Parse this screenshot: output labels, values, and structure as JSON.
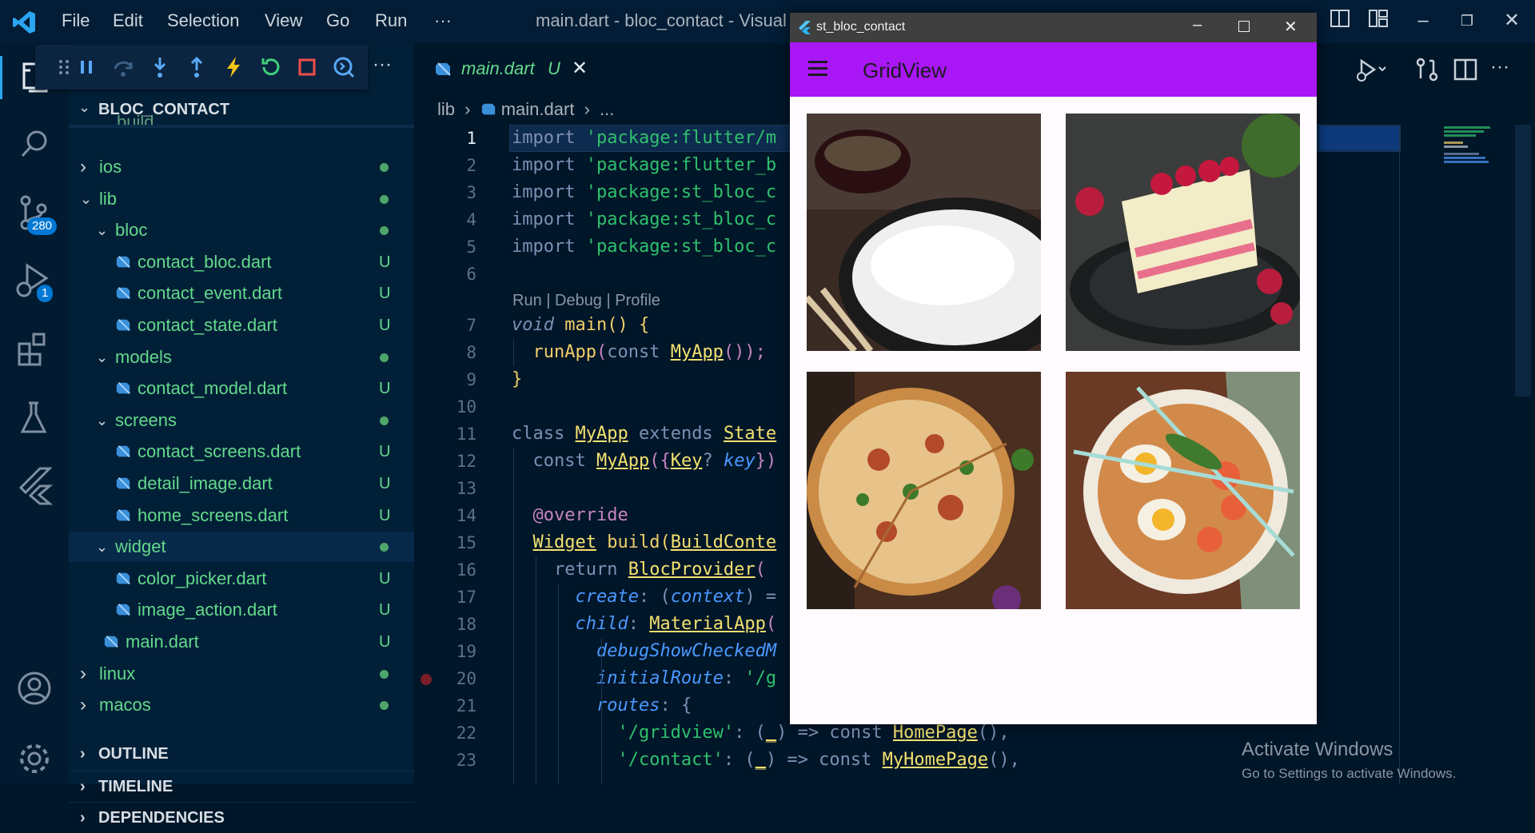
{
  "titlebar": {
    "menu": [
      "File",
      "Edit",
      "Selection",
      "View",
      "Go",
      "Run"
    ],
    "more": "···",
    "window_title": "main.dart - bloc_contact - Visual S"
  },
  "activity": {
    "scm_badge": "280",
    "debug_badge": "1"
  },
  "explorer": {
    "root": "BLOC_CONTACT",
    "cut_top": "build",
    "items": [
      {
        "name": "ios",
        "status": "dot"
      },
      {
        "name": "lib",
        "status": "dot"
      },
      {
        "name": "bloc",
        "status": "dot"
      },
      {
        "name": "contact_bloc.dart",
        "status": "U"
      },
      {
        "name": "contact_event.dart",
        "status": "U"
      },
      {
        "name": "contact_state.dart",
        "status": "U"
      },
      {
        "name": "models",
        "status": "dot"
      },
      {
        "name": "contact_model.dart",
        "status": "U"
      },
      {
        "name": "screens",
        "status": "dot"
      },
      {
        "name": "contact_screens.dart",
        "status": "U"
      },
      {
        "name": "detail_image.dart",
        "status": "U"
      },
      {
        "name": "home_screens.dart",
        "status": "U"
      },
      {
        "name": "widget",
        "status": "dot"
      },
      {
        "name": "color_picker.dart",
        "status": "U"
      },
      {
        "name": "image_action.dart",
        "status": "U"
      },
      {
        "name": "main.dart",
        "status": "U"
      },
      {
        "name": "linux",
        "status": "dot"
      },
      {
        "name": "macos",
        "status": "dot"
      }
    ],
    "sections": [
      "OUTLINE",
      "TIMELINE",
      "DEPENDENCIES"
    ]
  },
  "editor": {
    "tab": {
      "label": "main.dart",
      "status": "U"
    },
    "breadcrumb": [
      "lib",
      "main.dart",
      "..."
    ],
    "codelens": "Run | Debug | Profile",
    "line_numbers": [
      "1",
      "2",
      "3",
      "4",
      "5",
      "6",
      "7",
      "8",
      "9",
      "10",
      "11",
      "12",
      "13",
      "14",
      "15",
      "16",
      "17",
      "18",
      "19",
      "20",
      "21",
      "22",
      "23"
    ],
    "lines": {
      "l1a": "import ",
      "l1b": "'package:flutter/m",
      "l2a": "import ",
      "l2b": "'package:flutter_b",
      "l3a": "import ",
      "l3b": "'package:st_bloc_c",
      "l4a": "import ",
      "l4b": "'package:st_bloc_c",
      "l5a": "import ",
      "l5b": "'package:st_bloc_c",
      "l7a": "void ",
      "l7b": "main",
      "l7c": "() {",
      "l8a": "  runApp",
      "l8b": "(",
      "l8c": "const ",
      "l8d": "MyApp",
      "l8e": "());",
      "l9": "}",
      "l11a": "class ",
      "l11b": "MyApp",
      "l11c": " extends ",
      "l11d": "State",
      "l12a": "  const ",
      "l12b": "MyApp",
      "l12c": "({",
      "l12d": "Key",
      "l12e": "? ",
      "l12f": "key",
      "l12g": "})",
      "l14": "  @override",
      "l15a": "  ",
      "l15b": "Widget",
      "l15c": " build(",
      "l15d": "BuildConte",
      "l16a": "    return ",
      "l16b": "BlocProvider",
      "l16c": "(",
      "l17a": "      ",
      "l17b": "create",
      "l17c": ": (",
      "l17d": "context",
      "l17e": ") =",
      "l18a": "      ",
      "l18b": "child",
      "l18c": ": ",
      "l18d": "MaterialApp",
      "l18e": "(",
      "l19a": "        ",
      "l19b": "debugShowCheckedM",
      "l20a": "        ",
      "l20b": "initialRoute",
      "l20c": ": ",
      "l20d": "'/g",
      "l21a": "        ",
      "l21b": "routes",
      "l21c": ": {",
      "l22a": "          ",
      "l22b": "'/gridview'",
      "l22c": ": (",
      "l22d": "_",
      "l22e": ") => ",
      "l22f": "const ",
      "l22g": "HomePage",
      "l22h": "(),",
      "l23a": "          ",
      "l23b": "'/contact'",
      "l23c": ": (",
      "l23d": "_",
      "l23e": ") => ",
      "l23f": "const ",
      "l23g": "MyHomePage",
      "l23h": "(),"
    }
  },
  "app_window": {
    "title": "st_bloc_contact",
    "appbar_title": "GridView",
    "images": [
      "rice-bowl-image",
      "raspberry-cake-image",
      "pizza-image",
      "ramen-image"
    ]
  },
  "watermark": {
    "title": "Activate Windows",
    "subtitle": "Go to Settings to activate Windows."
  },
  "colors": {
    "appbar": "#a917f6",
    "editor_bg": "#001629",
    "untracked": "#64d98b"
  }
}
